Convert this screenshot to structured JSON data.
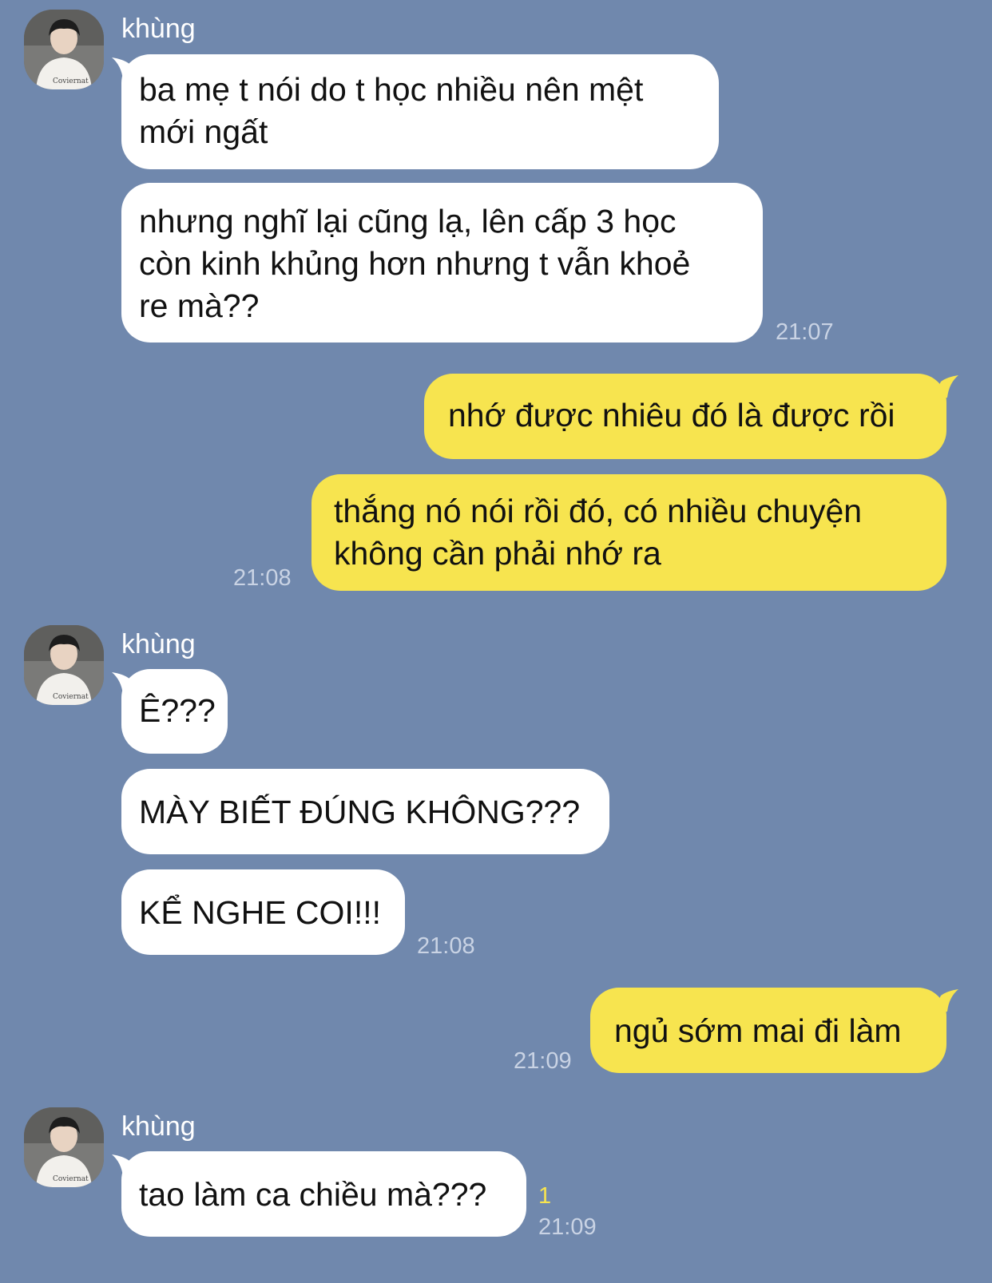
{
  "colors": {
    "background": "#7088ad",
    "incoming_bubble": "#ffffff",
    "outgoing_bubble": "#f7e44f",
    "time_text": "#c9d3e4",
    "unread_count": "#f7e44f"
  },
  "contact": {
    "name": "khùng",
    "avatar_icon": "profile-photo-icon"
  },
  "groups": [
    {
      "sender": "khùng",
      "messages": [
        "ba mẹ t nói do t học nhiều nên mệt\nmới ngất",
        "nhưng nghĩ lại cũng lạ, lên cấp 3 học\ncòn kinh khủng hơn nhưng t vẫn khoẻ\nre mà??"
      ],
      "time": "21:07"
    },
    {
      "sender": "me",
      "messages": [
        "nhớ được nhiêu đó là được rồi",
        "thắng nó nói rồi đó, có nhiều chuyện\nkhông cần phải nhớ ra"
      ],
      "time": "21:08"
    },
    {
      "sender": "khùng",
      "messages": [
        "Ê???",
        "MÀY BIẾT ĐÚNG KHÔNG???",
        "KỂ NGHE COI!!!"
      ],
      "time": "21:08"
    },
    {
      "sender": "me",
      "messages": [
        "ngủ sớm mai đi làm"
      ],
      "time": "21:09"
    },
    {
      "sender": "khùng",
      "messages": [
        "tao làm ca chiều mà???"
      ],
      "time": "21:09",
      "unread_count": "1"
    }
  ]
}
